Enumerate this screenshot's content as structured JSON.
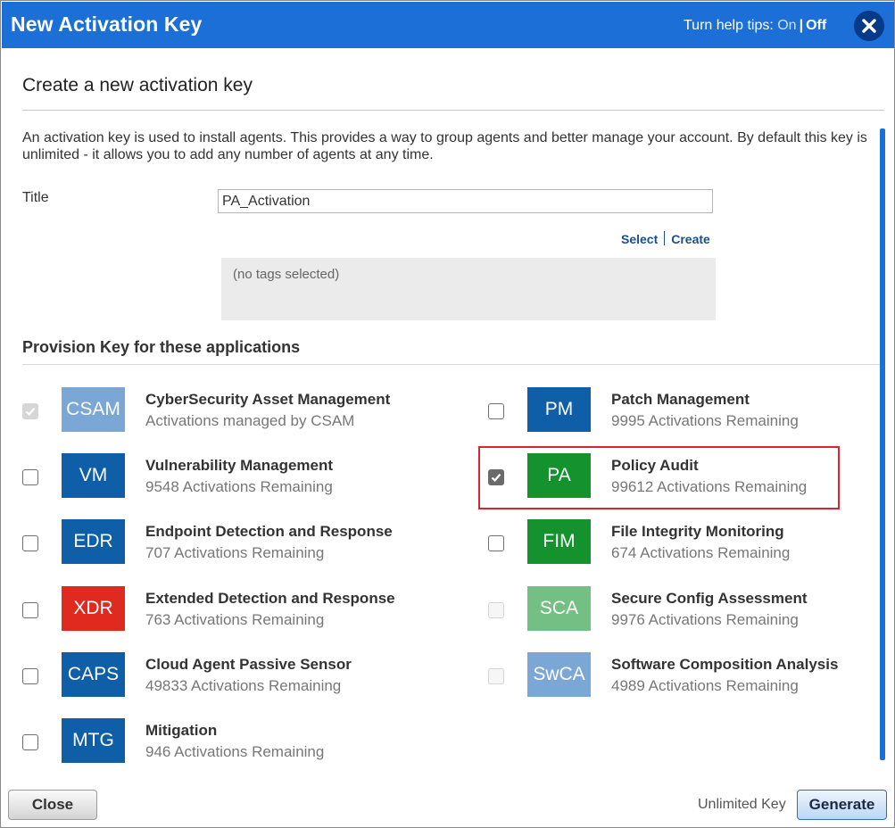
{
  "dialog": {
    "title": "New Activation Key",
    "help_prefix": "Turn help tips: ",
    "help_on": "On",
    "help_sep": "|",
    "help_off": "Off"
  },
  "form": {
    "subtitle": "Create a new activation key",
    "description": "An activation key is used to install agents. This provides a way to group agents and better manage your account. By default this key is unlimited - it allows you to add any number of agents at any time.",
    "title_label": "Title",
    "title_value": "PA_Activation",
    "tag_select": "Select",
    "tag_create": "Create",
    "tags_empty": "(no tags selected)"
  },
  "provision": {
    "heading": "Provision Key for these applications",
    "apps": [
      {
        "code": "CSAM",
        "name": "CyberSecurity Asset Management",
        "sub": "Activations managed by CSAM",
        "color": "#7ba7d6",
        "checked": true,
        "disabled": true
      },
      {
        "code": "PM",
        "name": "Patch Management",
        "sub": "9995 Activations Remaining",
        "color": "#0e5fa8",
        "checked": false,
        "disabled": false
      },
      {
        "code": "VM",
        "name": "Vulnerability Management",
        "sub": "9548 Activations Remaining",
        "color": "#0e5fa8",
        "checked": false,
        "disabled": false
      },
      {
        "code": "PA",
        "name": "Policy Audit",
        "sub": "99612 Activations Remaining",
        "color": "#14922e",
        "checked": true,
        "disabled": false
      },
      {
        "code": "EDR",
        "name": "Endpoint Detection and Response",
        "sub": "707 Activations Remaining",
        "color": "#0e5fa8",
        "checked": false,
        "disabled": false
      },
      {
        "code": "FIM",
        "name": "File Integrity Monitoring",
        "sub": "674 Activations Remaining",
        "color": "#14922e",
        "checked": false,
        "disabled": false
      },
      {
        "code": "XDR",
        "name": "Extended Detection and Response",
        "sub": "763 Activations Remaining",
        "color": "#e02a20",
        "checked": false,
        "disabled": false
      },
      {
        "code": "SCA",
        "name": "Secure Config Assessment",
        "sub": "9976 Activations Remaining",
        "color": "#74bf83",
        "checked": false,
        "disabled": true
      },
      {
        "code": "CAPS",
        "name": "Cloud Agent Passive Sensor",
        "sub": "49833 Activations Remaining",
        "color": "#0e5fa8",
        "checked": false,
        "disabled": false
      },
      {
        "code": "SwCA",
        "name": "Software Composition Analysis",
        "sub": "4989 Activations Remaining",
        "color": "#7ba7d6",
        "checked": false,
        "disabled": true
      },
      {
        "code": "MTG",
        "name": "Mitigation",
        "sub": "946 Activations Remaining",
        "color": "#0e5fa8",
        "checked": false,
        "disabled": false
      }
    ]
  },
  "footer": {
    "close_label": "Close",
    "unlimited_label": "Unlimited Key",
    "generate_label": "Generate"
  }
}
